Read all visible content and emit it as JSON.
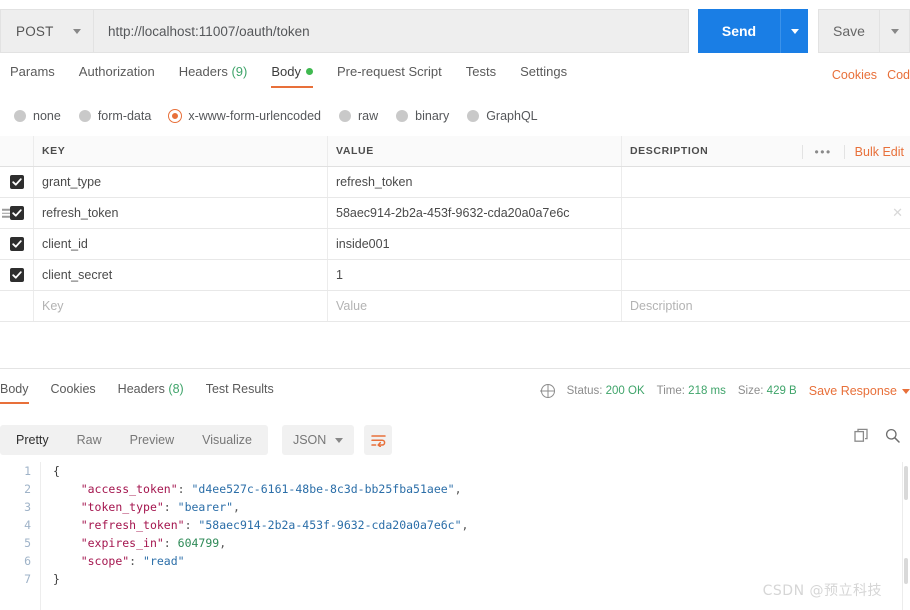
{
  "request": {
    "method": "POST",
    "url": "http://localhost:11007/oauth/token",
    "send_label": "Send",
    "save_label": "Save",
    "tabs": [
      {
        "label": "Params",
        "count": "",
        "active": false
      },
      {
        "label": "Authorization",
        "count": "",
        "active": false
      },
      {
        "label": "Headers",
        "count": "(9)",
        "active": false
      },
      {
        "label": "Body",
        "count": "",
        "active": true
      },
      {
        "label": "Pre-request Script",
        "count": "",
        "active": false
      },
      {
        "label": "Tests",
        "count": "",
        "active": false
      },
      {
        "label": "Settings",
        "count": "",
        "active": false
      }
    ],
    "right_links": [
      "Cookies",
      "Cod"
    ],
    "body_types": [
      {
        "label": "none",
        "selected": false
      },
      {
        "label": "form-data",
        "selected": false
      },
      {
        "label": "x-www-form-urlencoded",
        "selected": true
      },
      {
        "label": "raw",
        "selected": false
      },
      {
        "label": "binary",
        "selected": false
      },
      {
        "label": "GraphQL",
        "selected": false
      }
    ]
  },
  "params_table": {
    "headers": {
      "key": "KEY",
      "value": "VALUE",
      "description": "DESCRIPTION"
    },
    "bulk_edit_label": "Bulk Edit",
    "dots_label": "•••",
    "rows": [
      {
        "checked": true,
        "key": "grant_type",
        "value": "refresh_token",
        "description": ""
      },
      {
        "checked": true,
        "key": "refresh_token",
        "value": "58aec914-2b2a-453f-9632-cda20a0a7e6c",
        "description": ""
      },
      {
        "checked": true,
        "key": "client_id",
        "value": "inside001",
        "description": ""
      },
      {
        "checked": true,
        "key": "client_secret",
        "value": "1",
        "description": ""
      }
    ],
    "placeholder_row": {
      "key": "Key",
      "value": "Value",
      "description": "Description"
    }
  },
  "response": {
    "tabs": [
      {
        "label": "Body",
        "count": "",
        "active": true
      },
      {
        "label": "Cookies",
        "count": "",
        "active": false
      },
      {
        "label": "Headers",
        "count": "(8)",
        "active": false
      },
      {
        "label": "Test Results",
        "count": "",
        "active": false
      }
    ],
    "status_label": "Status:",
    "status_value": "200 OK",
    "time_label": "Time:",
    "time_value": "218 ms",
    "size_label": "Size:",
    "size_value": "429 B",
    "save_response_label": "Save Response",
    "view_modes": [
      {
        "label": "Pretty",
        "active": true
      },
      {
        "label": "Raw",
        "active": false
      },
      {
        "label": "Preview",
        "active": false
      },
      {
        "label": "Visualize",
        "active": false
      }
    ],
    "format": "JSON",
    "body_lines": [
      {
        "n": "1",
        "indent": 0,
        "tokens": [
          {
            "t": "{",
            "c": "b"
          }
        ]
      },
      {
        "n": "2",
        "indent": 1,
        "tokens": [
          {
            "t": "\"access_token\"",
            "c": "k"
          },
          {
            "t": ": ",
            "c": "p"
          },
          {
            "t": "\"d4ee527c-6161-48be-8c3d-bb25fba51aee\"",
            "c": "s"
          },
          {
            "t": ",",
            "c": "p"
          }
        ]
      },
      {
        "n": "3",
        "indent": 1,
        "tokens": [
          {
            "t": "\"token_type\"",
            "c": "k"
          },
          {
            "t": ": ",
            "c": "p"
          },
          {
            "t": "\"bearer\"",
            "c": "s"
          },
          {
            "t": ",",
            "c": "p"
          }
        ]
      },
      {
        "n": "4",
        "indent": 1,
        "tokens": [
          {
            "t": "\"refresh_token\"",
            "c": "k"
          },
          {
            "t": ": ",
            "c": "p"
          },
          {
            "t": "\"58aec914-2b2a-453f-9632-cda20a0a7e6c\"",
            "c": "s"
          },
          {
            "t": ",",
            "c": "p"
          }
        ]
      },
      {
        "n": "5",
        "indent": 1,
        "tokens": [
          {
            "t": "\"expires_in\"",
            "c": "k"
          },
          {
            "t": ": ",
            "c": "p"
          },
          {
            "t": "604799",
            "c": "n"
          },
          {
            "t": ",",
            "c": "p"
          }
        ]
      },
      {
        "n": "6",
        "indent": 1,
        "tokens": [
          {
            "t": "\"scope\"",
            "c": "k"
          },
          {
            "t": ": ",
            "c": "p"
          },
          {
            "t": "\"read\"",
            "c": "s"
          }
        ]
      },
      {
        "n": "7",
        "indent": 0,
        "tokens": [
          {
            "t": "}",
            "c": "b"
          }
        ]
      }
    ]
  },
  "watermark": "CSDN @预立科技"
}
